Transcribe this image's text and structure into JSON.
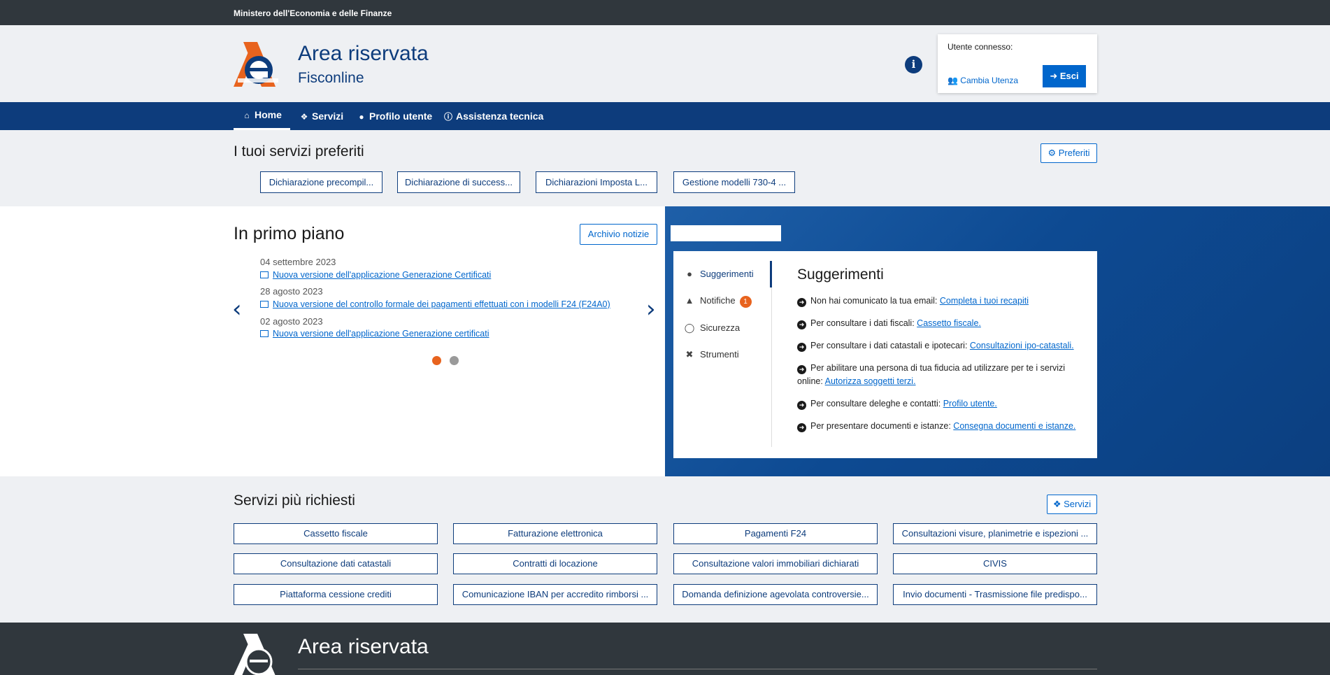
{
  "topbar": {
    "ministry": "Ministero dell'Economia e delle Finanze"
  },
  "header": {
    "title": "Area riservata",
    "subtitle": "Fisconline",
    "user_label": "Utente connesso:",
    "change_user": "Cambia Utenza",
    "logout": "Esci"
  },
  "nav": {
    "items": [
      {
        "label": "Home"
      },
      {
        "label": "Servizi"
      },
      {
        "label": "Profilo utente"
      },
      {
        "label": "Assistenza tecnica"
      }
    ]
  },
  "favorites": {
    "title": "I tuoi servizi preferiti",
    "button": "Preferiti",
    "items": [
      "Dichiarazione precompil...",
      "Dichiarazione di success...",
      "Dichiarazioni Imposta L...",
      "Gestione modelli 730-4 ..."
    ]
  },
  "news": {
    "title": "In primo piano",
    "archive_button": "Archivio notizie",
    "items": [
      {
        "date": "04 settembre 2023",
        "text": "Nuova versione dell'applicazione Generazione Certificati"
      },
      {
        "date": "28 agosto 2023",
        "text": "Nuova versione del controllo formale dei pagamenti effettuati con i modelli F24 (F24A0)"
      },
      {
        "date": "02 agosto 2023",
        "text": "Nuova versione dell'applicazione Generazione certificati"
      }
    ],
    "colors": {
      "active_dot": "#e8631e",
      "inactive_dot": "#9a9a9a"
    }
  },
  "panel": {
    "tabs": [
      {
        "label": "Suggerimenti",
        "icon": "lightbulb-icon"
      },
      {
        "label": "Notifiche",
        "icon": "bell-icon",
        "badge": "1"
      },
      {
        "label": "Sicurezza",
        "icon": "shield-icon"
      },
      {
        "label": "Strumenti",
        "icon": "tools-icon"
      }
    ],
    "title": "Suggerimenti",
    "rows": [
      {
        "text": "Non hai comunicato la tua email:",
        "link": "Completa i tuoi recapiti"
      },
      {
        "text": "Per consultare i dati fiscali:",
        "link": "Cassetto fiscale."
      },
      {
        "text": "Per consultare i dati catastali e ipotecari:",
        "link": "Consultazioni ipo-catastali."
      },
      {
        "text": "Per abilitare una persona di tua fiducia ad utilizzare per te i servizi online:",
        "link": "Autorizza soggetti terzi."
      },
      {
        "text": "Per consultare deleghe e contatti:",
        "link": "Profilo utente."
      },
      {
        "text": "Per presentare documenti e istanze:",
        "link": "Consegna documenti e istanze."
      }
    ]
  },
  "services": {
    "title": "Servizi più richiesti",
    "button": "Servizi",
    "items": [
      "Cassetto fiscale",
      "Fatturazione elettronica",
      "Pagamenti F24",
      "Consultazioni visure, planimetrie e ispezioni ...",
      "Consultazione dati catastali",
      "Contratti di locazione",
      "Consultazione valori immobiliari dichiarati",
      "CIVIS",
      "Piattaforma cessione crediti",
      "Comunicazione IBAN per accredito rimborsi ...",
      "Domanda definizione agevolata controversie...",
      "Invio documenti - Trasmissione file predispo..."
    ]
  },
  "footer": {
    "title": "Area riservata"
  },
  "colors": {
    "brand_blue": "#0d3c7c",
    "link_blue": "#0066cc",
    "accent_orange": "#e8631e",
    "dark": "#30373d"
  }
}
